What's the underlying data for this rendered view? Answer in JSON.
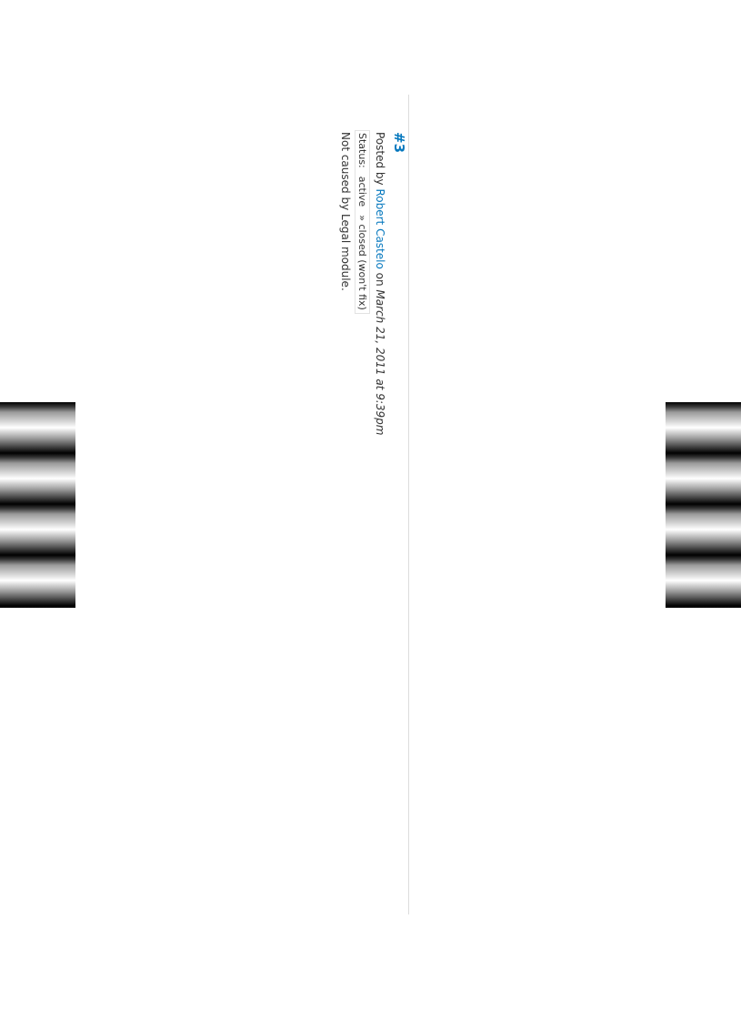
{
  "comment": {
    "number": "#3",
    "posted_by_label": "Posted by",
    "author": "Robert Castelo",
    "on_label": "on",
    "date": "March 21, 2011 at 9:39pm",
    "status": {
      "label": "Status:",
      "old_value": "active",
      "new_value": "» closed (won't fix)"
    },
    "body": "Not caused by Legal module."
  },
  "colors": {
    "link": "#0678be",
    "text": "#333333",
    "divider": "#dcdcdc"
  }
}
